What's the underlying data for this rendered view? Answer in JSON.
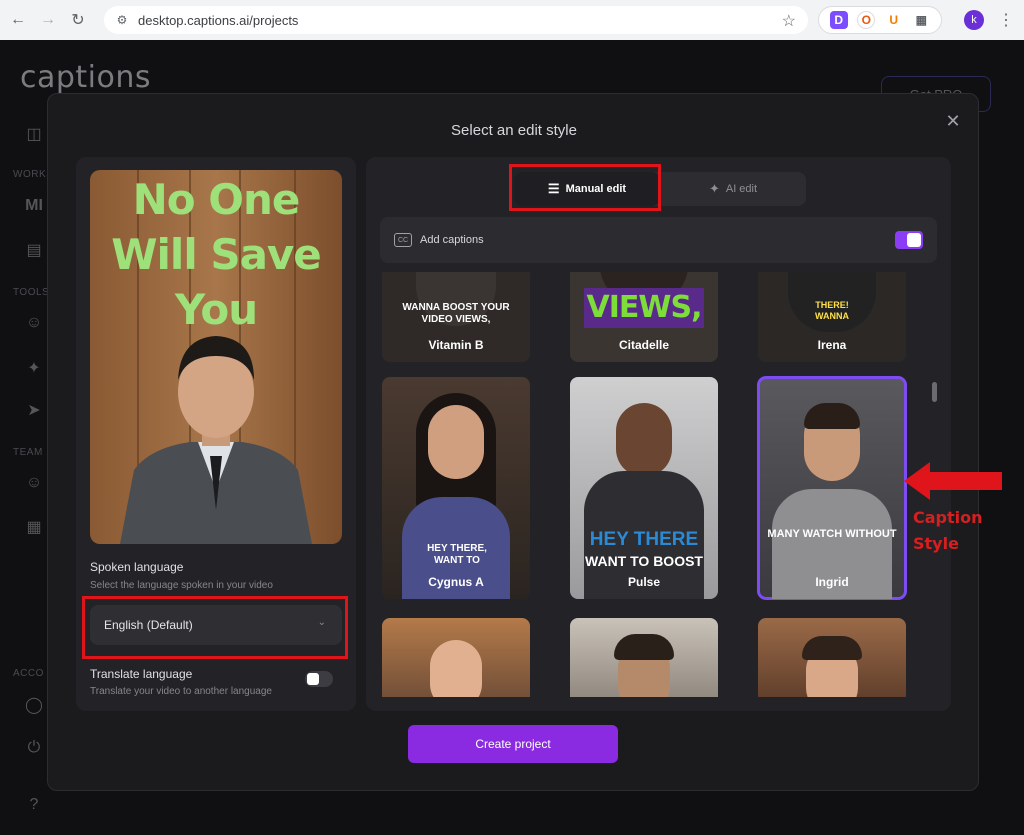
{
  "browser": {
    "url": "desktop.captions.ai/projects",
    "extensions": [
      "D",
      "O",
      "U"
    ],
    "profile_initial": "k"
  },
  "app": {
    "logo": "captions",
    "get_pro": "Get PRO",
    "sidebar_labels": [
      "WORKS",
      "TOOLS",
      "TEAM",
      "ACCO"
    ]
  },
  "modal": {
    "title": "Select an edit style",
    "tabs": {
      "manual": "Manual edit",
      "ai": "AI edit"
    },
    "add_captions": "Add captions",
    "preview_caption": [
      "No One",
      "Will Save",
      "You"
    ],
    "spoken_language": {
      "label": "Spoken language",
      "sub": "Select the language spoken in your video",
      "value": "English (Default)"
    },
    "translate": {
      "label": "Translate language",
      "sub": "Translate your video to another language"
    },
    "create_button": "Create project",
    "styles": [
      {
        "name": "Vitamin B",
        "caption": "WANNA BOOST YOUR VIDEO VIEWS,"
      },
      {
        "name": "Citadelle",
        "caption": "VIEWS,"
      },
      {
        "name": "Irena",
        "caption": "THERE! WANNA"
      },
      {
        "name": "Cygnus A",
        "caption": "HEY THERE, WANT TO"
      },
      {
        "name": "Pulse",
        "caption_1": "HEY THERE",
        "caption_2": "WANT TO BOOST"
      },
      {
        "name": "Ingrid",
        "caption": "MANY WATCH WITHOUT",
        "selected": true
      }
    ]
  },
  "annotation": {
    "line1": "Caption",
    "line2": "Style"
  },
  "colors": {
    "accent": "#8a2be2",
    "annotation": "#e0141b"
  }
}
